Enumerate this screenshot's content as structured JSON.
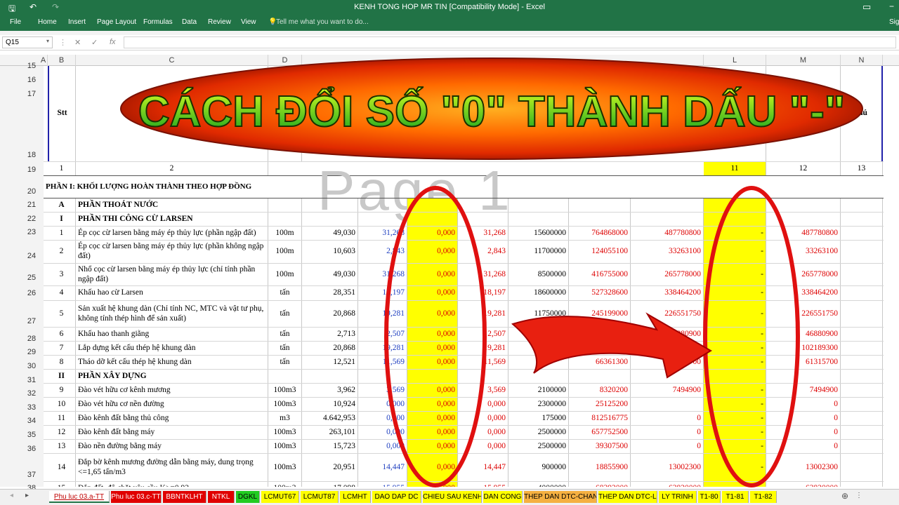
{
  "window": {
    "title": "KENH TONG HOP MR TIN  [Compatibility Mode] - Excel",
    "signin": "Sig"
  },
  "ribbon": {
    "tabs": [
      "File",
      "Home",
      "Insert",
      "Page Layout",
      "Formulas",
      "Data",
      "Review",
      "View"
    ],
    "tell_me": "Tell me what you want to do..."
  },
  "formula": {
    "namebox": "Q15",
    "cancel": "✕",
    "enter": "✓",
    "fx": "fx",
    "value": ""
  },
  "outline_levels": [
    "1",
    "2"
  ],
  "columns": [
    "A",
    "B",
    "C",
    "D",
    "L",
    "M",
    "N"
  ],
  "headers": {
    "stt": "Stt",
    "ghichu": "chú"
  },
  "rownums": [
    "15",
    "16",
    "17",
    "18",
    "19",
    "20",
    "21",
    "22",
    "23",
    "24",
    "25",
    "26",
    "27",
    "28",
    "29",
    "30",
    "31",
    "32",
    "33",
    "34",
    "35",
    "36",
    "37",
    "38"
  ],
  "colnums": [
    "1",
    "2",
    "11",
    "12",
    "13"
  ],
  "watermark": "Page 1",
  "banner": "CÁCH ĐỔI SỐ \"0\" THÀNH DẤU \"-\"",
  "section": "PHẦN I: KHỐI LƯỢNG HOÀN THÀNH THEO HỢP ĐỒNG",
  "rows": [
    {
      "stt": "A",
      "name": "PHẦN THOÁT NƯỚC",
      "bold": true,
      "u": "",
      "q": "",
      "e": "",
      "f": "",
      "g": "",
      "p": "",
      "h": "",
      "i": "",
      "k": "",
      "l": "",
      "m": ""
    },
    {
      "stt": "I",
      "name": "PHẦN THI CÔNG CỪ LARSEN",
      "bold": true,
      "u": "",
      "q": "",
      "e": "",
      "f": "",
      "g": "",
      "p": "",
      "h": "",
      "i": "",
      "k": "",
      "l": "",
      "m": ""
    },
    {
      "stt": "1",
      "name": "Ép cọc cừ larsen bằng máy ép thủy lực (phần ngập đất)",
      "u": "100m",
      "q": "49,030",
      "e": "31,268",
      "f": "0,000",
      "g": "31,268",
      "p": "15600000",
      "h": "764868000",
      "i": "487780800",
      "k": "-",
      "l": "487780800"
    },
    {
      "stt": "2",
      "name": "Ép cọc cừ larsen bằng máy ép thủy lực (phần không ngập đất)",
      "u": "100m",
      "q": "10,603",
      "e": "2,843",
      "f": "0,000",
      "g": "2,843",
      "p": "11700000",
      "h": "124055100",
      "i": "33263100",
      "k": "-",
      "l": "33263100"
    },
    {
      "stt": "3",
      "name": "Nhổ cọc cừ larsen bằng máy ép thủy lực (chỉ tính phần ngập đất)",
      "u": "100m",
      "q": "49,030",
      "e": "31,268",
      "f": "0,000",
      "g": "31,268",
      "p": "8500000",
      "h": "416755000",
      "i": "265778000",
      "k": "-",
      "l": "265778000"
    },
    {
      "stt": "4",
      "name": "Khấu hao cừ Larsen",
      "u": "tấn",
      "q": "28,351",
      "e": "18,197",
      "f": "0,000",
      "g": "18,197",
      "p": "18600000",
      "h": "527328600",
      "i": "338464200",
      "k": "-",
      "l": "338464200"
    },
    {
      "stt": "5",
      "name": "Sản xuất hệ khung dàn (Chỉ tính NC, MTC và vật tư phụ, không tính thép hình để sản xuất)",
      "u": "tấn",
      "q": "20,868",
      "e": "19,281",
      "f": "0,000",
      "g": "19,281",
      "p": "11750000",
      "h": "245199000",
      "i": "226551750",
      "k": "-",
      "l": "226551750"
    },
    {
      "stt": "6",
      "name": "Khấu hao thanh giằng",
      "u": "tấn",
      "q": "2,713",
      "e": "2,507",
      "f": "0,000",
      "g": "2,507",
      "p": "",
      "h": "",
      "i": "46880900",
      "k": "-",
      "l": "46880900"
    },
    {
      "stt": "7",
      "name": "Lắp dựng kết cấu thép hệ khung dàn",
      "u": "tấn",
      "q": "20,868",
      "e": "19,281",
      "f": "0,000",
      "g": "19,281",
      "p": "",
      "h": "",
      "i": "102189300",
      "k": "-",
      "l": "102189300"
    },
    {
      "stt": "8",
      "name": "Tháo dỡ kết cấu thép hệ khung dàn",
      "u": "tấn",
      "q": "12,521",
      "e": "11,569",
      "f": "0,000",
      "g": "11,569",
      "p": "",
      "h": "66361300",
      "i": "61315700",
      "k": "-",
      "l": "61315700"
    },
    {
      "stt": "II",
      "name": "PHẦN XÂY DỰNG",
      "bold": true,
      "u": "",
      "q": "",
      "e": "",
      "f": "",
      "g": "",
      "p": "",
      "h": "",
      "i": "",
      "k": "",
      "l": "",
      "m": ""
    },
    {
      "stt": "9",
      "name": "Đào vét hữu cơ kênh mương",
      "u": "100m3",
      "q": "3,962",
      "e": "3,569",
      "f": "0,000",
      "g": "3,569",
      "p": "2100000",
      "h": "8320200",
      "i": "7494900",
      "k": "-",
      "l": "7494900"
    },
    {
      "stt": "10",
      "name": "Đào vét hữu cơ nền đường",
      "u": "100m3",
      "q": "10,924",
      "e": "0,000",
      "f": "0,000",
      "g": "0,000",
      "p": "2300000",
      "h": "25125200",
      "i": "",
      "k": "-",
      "l": "0"
    },
    {
      "stt": "11",
      "name": "Đào kênh đất bằng thủ công",
      "u": "m3",
      "q": "4.642,953",
      "e": "0,000",
      "f": "0,000",
      "g": "0,000",
      "p": "175000",
      "h": "812516775",
      "i": "0",
      "k": "-",
      "l": "0"
    },
    {
      "stt": "12",
      "name": "Đào kênh đất bằng máy",
      "u": "100m3",
      "q": "263,101",
      "e": "0,000",
      "f": "0,000",
      "g": "0,000",
      "p": "2500000",
      "h": "657752500",
      "i": "0",
      "k": "-",
      "l": "0"
    },
    {
      "stt": "13",
      "name": "Đào nền đường bằng máy",
      "u": "100m3",
      "q": "15,723",
      "e": "0,000",
      "f": "0,000",
      "g": "0,000",
      "p": "2500000",
      "h": "39307500",
      "i": "0",
      "k": "-",
      "l": "0"
    },
    {
      "stt": "14",
      "name": "Đắp bờ kênh mương đường dẫn bằng máy, dung trọng <=1,65 tấn/m3",
      "u": "100m3",
      "q": "20,951",
      "e": "14,447",
      "f": "0,000",
      "g": "14,447",
      "p": "900000",
      "h": "18855900",
      "i": "13002300",
      "k": "-",
      "l": "13002300"
    },
    {
      "stt": "15",
      "name": "Đắp đất, độ chặt yêu cầu K>=0,92",
      "u": "100m3",
      "q": "17,098",
      "e": "15,955",
      "f": "0,000",
      "g": "15,955",
      "p": "4000000",
      "h": "68392000",
      "i": "63820000",
      "k": "-",
      "l": "63820000"
    }
  ],
  "sheets": [
    {
      "name": "Phu luc 03.a-TT",
      "bg": "#ffffff",
      "fg": "#c00000",
      "active": true
    },
    {
      "name": "Phu luc 03.c-TT",
      "bg": "#e00000",
      "fg": "#ffffff"
    },
    {
      "name": "BBNTKLHT",
      "bg": "#e00000",
      "fg": "#ffffff"
    },
    {
      "name": "NTKL",
      "bg": "#e00000",
      "fg": "#ffffff"
    },
    {
      "name": "DGKL",
      "bg": "#22cc22",
      "fg": "#000000"
    },
    {
      "name": "LCMUT67",
      "bg": "#ffff00",
      "fg": "#000000"
    },
    {
      "name": "LCMUT87",
      "bg": "#ffff00",
      "fg": "#000000"
    },
    {
      "name": "LCMHT",
      "bg": "#ffff00",
      "fg": "#000000"
    },
    {
      "name": "DAO DAP DC",
      "bg": "#ffff00",
      "fg": "#000000"
    },
    {
      "name": "CHIEU SAU KENH",
      "bg": "#ffff00",
      "fg": "#000000"
    },
    {
      "name": "DAN CONG",
      "bg": "#ffff00",
      "fg": "#000000"
    },
    {
      "name": "THEP DAN DTC-CHAN",
      "bg": "#f5b041",
      "fg": "#000000"
    },
    {
      "name": "THEP DAN DTC-LE",
      "bg": "#ffff00",
      "fg": "#000000"
    },
    {
      "name": "LY TRINH",
      "bg": "#ffff00",
      "fg": "#000000"
    },
    {
      "name": "T1-80",
      "bg": "#ffff00",
      "fg": "#000000"
    },
    {
      "name": "T1-81",
      "bg": "#ffff00",
      "fg": "#000000"
    },
    {
      "name": "T1-82",
      "bg": "#ffff00",
      "fg": "#000000"
    }
  ],
  "colors": {
    "excel_green": "#217346",
    "highlight": "#ffff00",
    "annotation": "#e01010"
  }
}
